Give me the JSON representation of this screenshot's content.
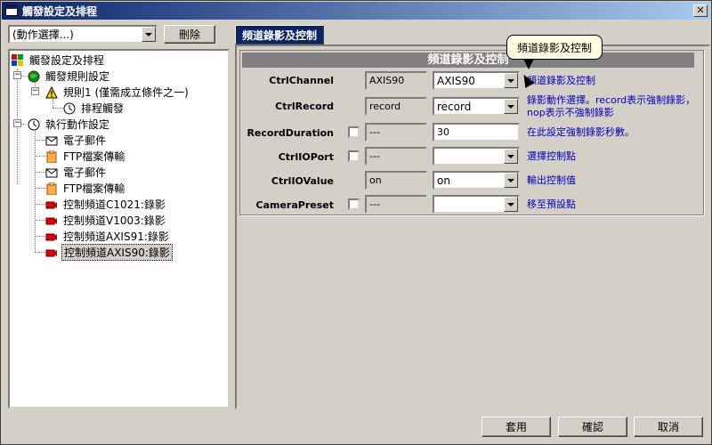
{
  "window": {
    "title": "觸發設定及排程",
    "close_label": "✕"
  },
  "toolbar": {
    "action_select_value": "(動作選擇...)",
    "delete_label": "刪除"
  },
  "tree": {
    "items": [
      {
        "label": "觸發設定及排程"
      },
      {
        "label": "觸發規則設定"
      },
      {
        "label": "規則1 (僅需成立條件之一)"
      },
      {
        "label": "排程觸發"
      },
      {
        "label": "執行動作設定"
      },
      {
        "label": "電子郵件"
      },
      {
        "label": "FTP檔案傳輸"
      },
      {
        "label": "電子郵件"
      },
      {
        "label": "FTP檔案傳輸"
      },
      {
        "label": "控制頻道C1021:錄影"
      },
      {
        "label": "控制頻道V1003:錄影"
      },
      {
        "label": "控制頻道AXIS91:錄影"
      },
      {
        "label": "控制頻道AXIS90:錄影"
      }
    ]
  },
  "tab": {
    "label": "頻道錄影及控制"
  },
  "group": {
    "title": "頻道錄影及控制"
  },
  "tooltip": {
    "text": "頻道錄影及控制"
  },
  "rows": [
    {
      "label": "CtrlChannel",
      "readonly": "AXIS90",
      "value": "AXIS90",
      "desc": "頻道錄影及控制"
    },
    {
      "label": "CtrlRecord",
      "readonly": "record",
      "value": "record",
      "desc": "錄影動作選擇。record表示強制錄影，nop表示不強制錄影"
    },
    {
      "label": "RecordDuration",
      "readonly": "---",
      "value": "30",
      "desc": "在此設定強制錄影秒數。"
    },
    {
      "label": "CtrlIOPort",
      "readonly": "---",
      "value": "",
      "desc": "選擇控制點"
    },
    {
      "label": "CtrlIOValue",
      "readonly": "on",
      "value": "on",
      "desc": "輸出控制值"
    },
    {
      "label": "CameraPreset",
      "readonly": "---",
      "value": "",
      "desc": "移至預設點"
    }
  ],
  "footer": {
    "apply_label": "套用",
    "ok_label": "確認",
    "cancel_label": "取消"
  }
}
